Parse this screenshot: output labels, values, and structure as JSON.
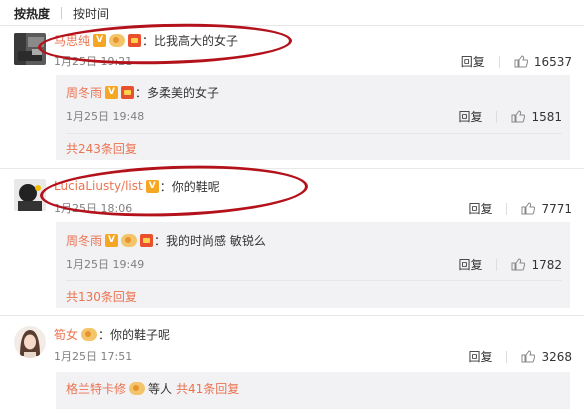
{
  "tabs": {
    "hot": "按热度",
    "time": "按时间"
  },
  "comments": [
    {
      "user": "马思纯",
      "text": "比我高大的女子",
      "time": "1月25日 19:21",
      "reply": "回复",
      "likes": "16537",
      "replies": [
        {
          "user": "周冬雨",
          "text": "多柔美的女子",
          "time": "1月25日 19:48",
          "reply": "回复",
          "likes": "1581"
        }
      ],
      "more": "共243条回复"
    },
    {
      "user": "LuciaLiusty/list",
      "text": "你的鞋呢",
      "time": "1月25日 18:06",
      "reply": "回复",
      "likes": "7771",
      "replies": [
        {
          "user": "周冬雨",
          "text": "我的时尚感 敏锐么",
          "time": "1月25日 19:49",
          "reply": "回复",
          "likes": "1782"
        }
      ],
      "more": "共130条回复"
    },
    {
      "user": "筍女",
      "text": "你的鞋子呢",
      "time": "1月25日 17:51",
      "reply": "回复",
      "likes": "3268",
      "replies_summary": {
        "user": "格兰特卡修",
        "text": "等人",
        "count": "共41条回复"
      }
    }
  ],
  "colors": {
    "username": "#eb7350",
    "highlight": "#b4121b",
    "sub_bg": "#f2f2f5"
  }
}
